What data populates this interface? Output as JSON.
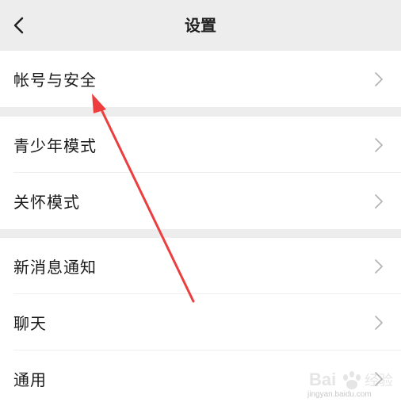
{
  "header": {
    "title": "设置",
    "back_icon": "chevron-left-icon"
  },
  "groups": [
    {
      "items": [
        {
          "label": "帐号与安全"
        }
      ]
    },
    {
      "items": [
        {
          "label": "青少年模式"
        },
        {
          "label": "关怀模式"
        }
      ]
    },
    {
      "items": [
        {
          "label": "新消息通知"
        },
        {
          "label": "聊天"
        },
        {
          "label": "通用"
        }
      ]
    }
  ],
  "annotation": {
    "arrow_color": "#ec3e3e"
  },
  "watermark": {
    "brand": "Baidu 经验",
    "url": "jingyan.baidu.com"
  }
}
